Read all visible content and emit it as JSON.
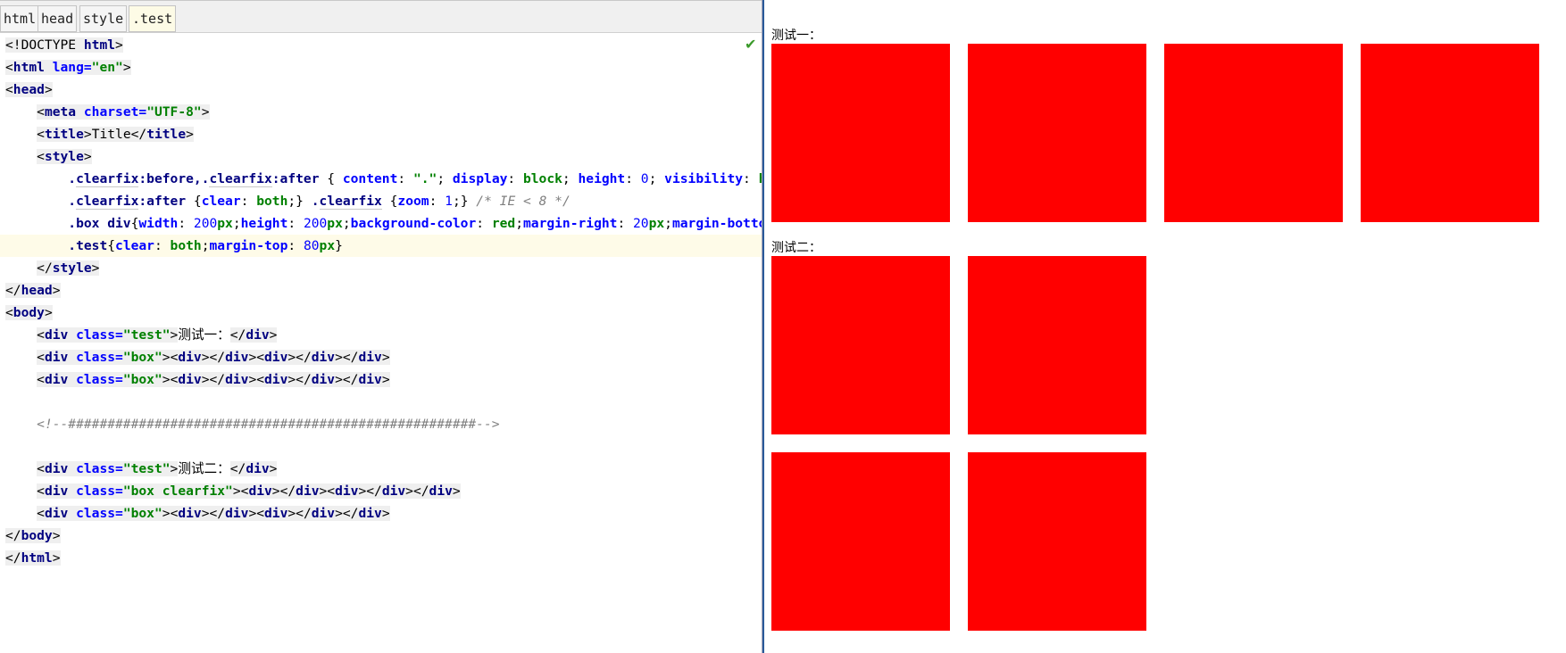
{
  "breadcrumbs": [
    {
      "label": "html"
    },
    {
      "label": "head"
    },
    {
      "label": "style"
    },
    {
      "label": ".test",
      "active": true
    }
  ],
  "editor": {
    "status_icon": "check-icon",
    "current_line": 9,
    "lines": [
      [
        [
          "br",
          "<!DOCTYPE "
        ],
        [
          "tag",
          "html"
        ],
        [
          "br",
          ">"
        ]
      ],
      [
        [
          "br",
          "<"
        ],
        [
          "tag",
          "html "
        ],
        [
          "attr",
          "lang="
        ],
        [
          "val",
          "\"en\""
        ],
        [
          "br",
          ">"
        ]
      ],
      [
        [
          "br",
          "<"
        ],
        [
          "tag",
          "head"
        ],
        [
          "br",
          ">"
        ]
      ],
      [
        [
          "txt",
          "    "
        ],
        [
          "br",
          "<"
        ],
        [
          "tag",
          "meta "
        ],
        [
          "attr",
          "charset="
        ],
        [
          "val",
          "\"UTF-8\""
        ],
        [
          "br",
          ">"
        ]
      ],
      [
        [
          "txt",
          "    "
        ],
        [
          "br",
          "<"
        ],
        [
          "tag",
          "title"
        ],
        [
          "br",
          ">"
        ],
        [
          "txtbg",
          "Title"
        ],
        [
          "br",
          "</"
        ],
        [
          "tag",
          "title"
        ],
        [
          "br",
          ">"
        ]
      ],
      [
        [
          "txt",
          "    "
        ],
        [
          "br",
          "<"
        ],
        [
          "tag",
          "style"
        ],
        [
          "br",
          ">"
        ]
      ],
      [
        [
          "txt",
          "        "
        ],
        [
          "sel",
          "."
        ],
        [
          "selu",
          "clearfix"
        ],
        [
          "sel",
          ":before,."
        ],
        [
          "selu",
          "clearfix"
        ],
        [
          "sel",
          ":after "
        ],
        [
          "pun",
          "{ "
        ],
        [
          "prop",
          "content"
        ],
        [
          "pun",
          ": "
        ],
        [
          "cval",
          "\".\""
        ],
        [
          "pun",
          "; "
        ],
        [
          "prop",
          "display"
        ],
        [
          "pun",
          ": "
        ],
        [
          "cval",
          "block"
        ],
        [
          "pun",
          "; "
        ],
        [
          "prop",
          "height"
        ],
        [
          "pun",
          ": "
        ],
        [
          "num",
          "0"
        ],
        [
          "pun",
          "; "
        ],
        [
          "prop",
          "visibility"
        ],
        [
          "pun",
          ": "
        ],
        [
          "cval",
          "hi"
        ]
      ],
      [
        [
          "txt",
          "        "
        ],
        [
          "sel",
          "."
        ],
        [
          "selu",
          "clearfix"
        ],
        [
          "sel",
          ":after "
        ],
        [
          "pun",
          "{"
        ],
        [
          "prop",
          "clear"
        ],
        [
          "pun",
          ": "
        ],
        [
          "cval",
          "both"
        ],
        [
          "pun",
          ";} "
        ],
        [
          "sel",
          "."
        ],
        [
          "selu",
          "clearfix"
        ],
        [
          "pun",
          " {"
        ],
        [
          "prop",
          "zoom"
        ],
        [
          "pun",
          ": "
        ],
        [
          "num",
          "1"
        ],
        [
          "pun",
          ";} "
        ],
        [
          "com",
          "/* IE < 8 */"
        ]
      ],
      [
        [
          "txt",
          "        "
        ],
        [
          "sel",
          ".box div"
        ],
        [
          "pun",
          "{"
        ],
        [
          "prop",
          "width"
        ],
        [
          "pun",
          ": "
        ],
        [
          "num",
          "200"
        ],
        [
          "cval",
          "px"
        ],
        [
          "pun",
          ";"
        ],
        [
          "prop",
          "height"
        ],
        [
          "pun",
          ": "
        ],
        [
          "num",
          "200"
        ],
        [
          "cval",
          "px"
        ],
        [
          "pun",
          ";"
        ],
        [
          "prop",
          "background-color"
        ],
        [
          "pun",
          ": "
        ],
        [
          "cval",
          "red"
        ],
        [
          "pun",
          ";"
        ],
        [
          "prop",
          "margin-right"
        ],
        [
          "pun",
          ": "
        ],
        [
          "num",
          "20"
        ],
        [
          "cval",
          "px"
        ],
        [
          "pun",
          ";"
        ],
        [
          "prop",
          "margin-bottom"
        ]
      ],
      [
        [
          "txt",
          "        "
        ],
        [
          "sel",
          ".test"
        ],
        [
          "pun",
          "{"
        ],
        [
          "prop",
          "clear"
        ],
        [
          "pun",
          ": "
        ],
        [
          "cval",
          "both"
        ],
        [
          "pun",
          ";"
        ],
        [
          "prop",
          "margin-top"
        ],
        [
          "pun",
          ": "
        ],
        [
          "num",
          "80"
        ],
        [
          "cval",
          "px"
        ],
        [
          "pun",
          "}"
        ]
      ],
      [
        [
          "txt",
          "    "
        ],
        [
          "br",
          "</"
        ],
        [
          "tag",
          "style"
        ],
        [
          "br",
          ">"
        ]
      ],
      [
        [
          "br",
          "</"
        ],
        [
          "tag",
          "head"
        ],
        [
          "br",
          ">"
        ]
      ],
      [
        [
          "br",
          "<"
        ],
        [
          "tag",
          "body"
        ],
        [
          "br",
          ">"
        ]
      ],
      [
        [
          "txt",
          "    "
        ],
        [
          "br",
          "<"
        ],
        [
          "tag",
          "div "
        ],
        [
          "attr",
          "class="
        ],
        [
          "val",
          "\"test\""
        ],
        [
          "br",
          ">"
        ],
        [
          "txt",
          "测试一："
        ],
        [
          "br",
          "</"
        ],
        [
          "tag",
          "div"
        ],
        [
          "br",
          ">"
        ]
      ],
      [
        [
          "txt",
          "    "
        ],
        [
          "br",
          "<"
        ],
        [
          "tag",
          "div "
        ],
        [
          "attr",
          "class="
        ],
        [
          "val",
          "\"box\""
        ],
        [
          "br",
          ">"
        ],
        [
          "br",
          "<"
        ],
        [
          "tag",
          "div"
        ],
        [
          "br",
          "></"
        ],
        [
          "tag",
          "div"
        ],
        [
          "br",
          "><"
        ],
        [
          "tag",
          "div"
        ],
        [
          "br",
          "></"
        ],
        [
          "tag",
          "div"
        ],
        [
          "br",
          "></"
        ],
        [
          "tag",
          "div"
        ],
        [
          "br",
          ">"
        ]
      ],
      [
        [
          "txt",
          "    "
        ],
        [
          "br",
          "<"
        ],
        [
          "tag",
          "div "
        ],
        [
          "attr",
          "class="
        ],
        [
          "val",
          "\"box\""
        ],
        [
          "br",
          ">"
        ],
        [
          "br",
          "<"
        ],
        [
          "tag",
          "div"
        ],
        [
          "br",
          "></"
        ],
        [
          "tag",
          "div"
        ],
        [
          "br",
          "><"
        ],
        [
          "tag",
          "div"
        ],
        [
          "br",
          "></"
        ],
        [
          "tag",
          "div"
        ],
        [
          "br",
          "></"
        ],
        [
          "tag",
          "div"
        ],
        [
          "br",
          ">"
        ]
      ],
      [],
      [
        [
          "txt",
          "    "
        ],
        [
          "com",
          "<!--####################################################-->"
        ]
      ],
      [],
      [
        [
          "txt",
          "    "
        ],
        [
          "br",
          "<"
        ],
        [
          "tag",
          "div "
        ],
        [
          "attr",
          "class="
        ],
        [
          "val",
          "\"test\""
        ],
        [
          "br",
          ">"
        ],
        [
          "txt",
          "测试二："
        ],
        [
          "br",
          "</"
        ],
        [
          "tag",
          "div"
        ],
        [
          "br",
          ">"
        ]
      ],
      [
        [
          "txt",
          "    "
        ],
        [
          "br",
          "<"
        ],
        [
          "tag",
          "div "
        ],
        [
          "attr",
          "class="
        ],
        [
          "val",
          "\"box clearfix\""
        ],
        [
          "br",
          ">"
        ],
        [
          "br",
          "<"
        ],
        [
          "tag",
          "div"
        ],
        [
          "br",
          "></"
        ],
        [
          "tag",
          "div"
        ],
        [
          "br",
          "><"
        ],
        [
          "tag",
          "div"
        ],
        [
          "br",
          "></"
        ],
        [
          "tag",
          "div"
        ],
        [
          "br",
          "></"
        ],
        [
          "tag",
          "div"
        ],
        [
          "br",
          ">"
        ]
      ],
      [
        [
          "txt",
          "    "
        ],
        [
          "br",
          "<"
        ],
        [
          "tag",
          "div "
        ],
        [
          "attr",
          "class="
        ],
        [
          "val",
          "\"box\""
        ],
        [
          "br",
          ">"
        ],
        [
          "br",
          "<"
        ],
        [
          "tag",
          "div"
        ],
        [
          "br",
          "></"
        ],
        [
          "tag",
          "div"
        ],
        [
          "br",
          "><"
        ],
        [
          "tag",
          "div"
        ],
        [
          "br",
          "></"
        ],
        [
          "tag",
          "div"
        ],
        [
          "br",
          "></"
        ],
        [
          "tag",
          "div"
        ],
        [
          "br",
          ">"
        ]
      ],
      [
        [
          "br",
          "</"
        ],
        [
          "tag",
          "body"
        ],
        [
          "br",
          ">"
        ]
      ],
      [
        [
          "br",
          "</"
        ],
        [
          "tag",
          "html"
        ],
        [
          "br",
          ">"
        ]
      ]
    ]
  },
  "preview": {
    "box_color": "#ff0000",
    "test1_label": "测试一：",
    "test2_label": "测试二："
  }
}
